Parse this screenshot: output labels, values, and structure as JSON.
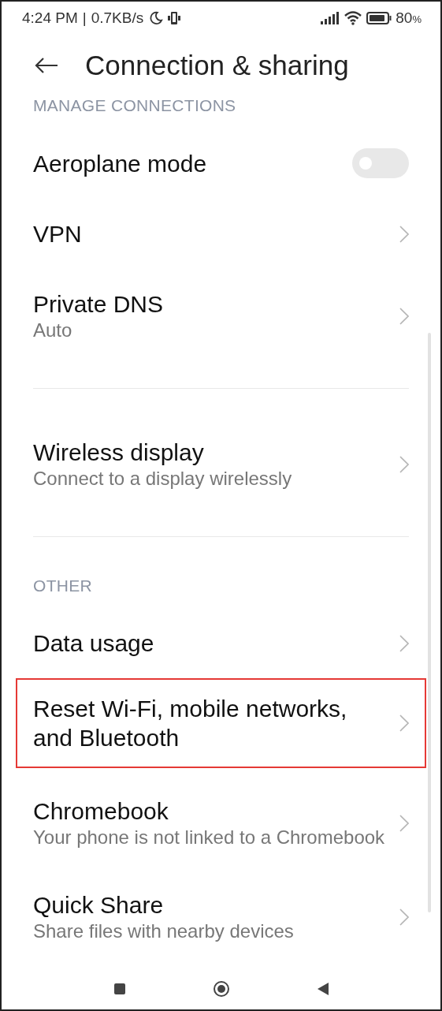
{
  "status_bar": {
    "time": "4:24 PM",
    "separator": "|",
    "speed": "0.7KB/s",
    "battery": "80",
    "battery_unit": "%"
  },
  "header": {
    "title": "Connection & sharing"
  },
  "groups": [
    {
      "header": "MANAGE CONNECTIONS",
      "items": [
        {
          "kind": "toggle",
          "title": "Aeroplane mode",
          "on": false,
          "highlighted": false
        },
        {
          "kind": "link",
          "title": "VPN",
          "highlighted": false
        },
        {
          "kind": "link",
          "title": "Private DNS",
          "subtitle": "Auto",
          "highlighted": false
        }
      ]
    },
    {
      "items": [
        {
          "kind": "link",
          "title": "Wireless display",
          "subtitle": "Connect to a display wirelessly",
          "highlighted": false
        }
      ]
    },
    {
      "header": "OTHER",
      "items": [
        {
          "kind": "link",
          "title": "Data usage",
          "highlighted": false
        },
        {
          "kind": "link",
          "title": "Reset Wi-Fi, mobile networks, and Bluetooth",
          "highlighted": true
        },
        {
          "kind": "link",
          "title": "Chromebook",
          "subtitle": "Your phone is not linked to a Chromebook",
          "highlighted": false
        },
        {
          "kind": "link",
          "title": "Quick Share",
          "subtitle": "Share files with nearby devices",
          "highlighted": false
        }
      ]
    }
  ]
}
